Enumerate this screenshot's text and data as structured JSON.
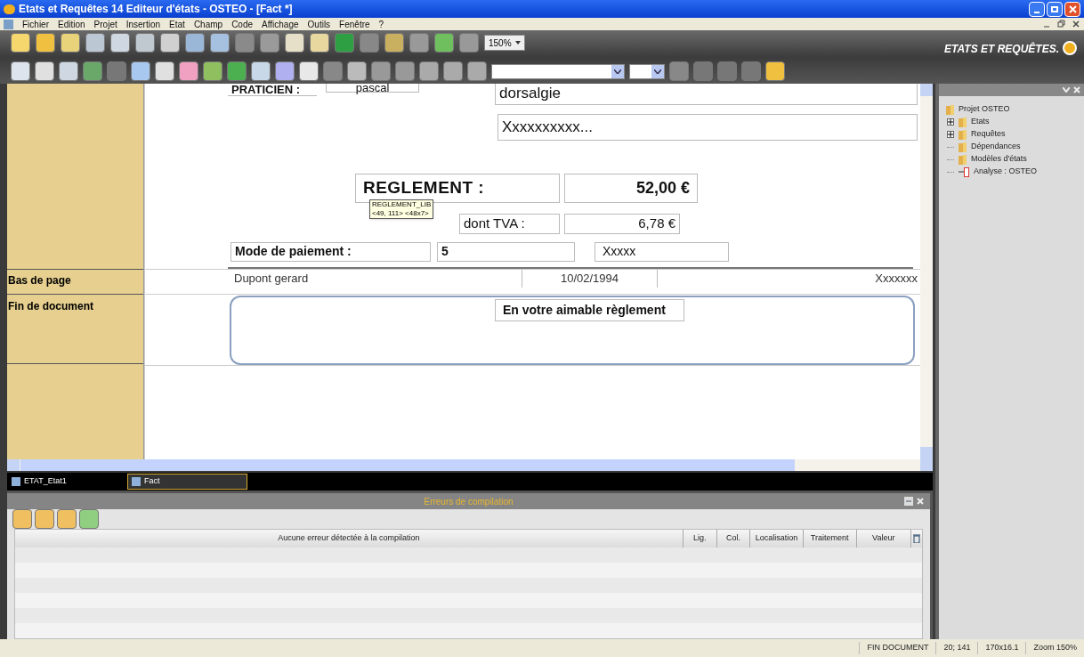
{
  "window": {
    "title": "Etats et Requêtes 14  Editeur d'états - OSTEO - [Fact *]"
  },
  "menu": [
    "Fichier",
    "Edition",
    "Projet",
    "Insertion",
    "Etat",
    "Champ",
    "Code",
    "Affichage",
    "Outils",
    "Fenêtre",
    "?"
  ],
  "toolbar": {
    "zoom": "150%"
  },
  "logo": {
    "text": "ETATS ET REQUÊTES."
  },
  "report": {
    "sections": [
      {
        "label": "Bas de page"
      },
      {
        "label": "Fin de document"
      }
    ],
    "fields": [
      {
        "text": "PRATICIEN :"
      },
      {
        "text": "pascal"
      },
      {
        "text": "dorsalgie"
      },
      {
        "text": "Xxxxxxxxxx..."
      },
      {
        "text": "REGLEMENT :"
      },
      {
        "text": "52,00 €"
      },
      {
        "text": "dont TVA :"
      },
      {
        "text": "6,78 €"
      },
      {
        "text": "Mode de paiement :"
      },
      {
        "text": "5"
      },
      {
        "text": "Xxxxx"
      },
      {
        "text": "Dupont gerard"
      },
      {
        "text": "10/02/1994"
      },
      {
        "text": "Xxxxxxx"
      },
      {
        "text": "En votre aimable règlement"
      }
    ],
    "tooltip": {
      "lines": [
        "REGLEMENT_LIB",
        "<49, 111> <48x7>"
      ]
    }
  },
  "doc_tabs": [
    {
      "label": "ETAT_Etat1",
      "selected": false
    },
    {
      "label": "Fact",
      "selected": true
    }
  ],
  "project_tree": {
    "label": "Projet OSTEO",
    "children": [
      {
        "label": "Etats",
        "kind": "folder",
        "expandable": true
      },
      {
        "label": "Requêtes",
        "kind": "folder",
        "expandable": true
      },
      {
        "label": "Dépendances",
        "kind": "folder",
        "expandable": false
      },
      {
        "label": "Modèles d'états",
        "kind": "folder",
        "expandable": false
      },
      {
        "label": "Analyse : OSTEO",
        "kind": "analysis",
        "expandable": false
      }
    ]
  },
  "errors_panel": {
    "title": "Erreurs de compilation",
    "columns": [
      "Aucune erreur détectée à la compilation",
      "Lig.",
      "Col.",
      "Localisation",
      "Traitement",
      "Valeur"
    ]
  },
  "status_bar": [
    "FIN DOCUMENT",
    "20; 141",
    "170x16.1",
    "Zoom 150%"
  ]
}
